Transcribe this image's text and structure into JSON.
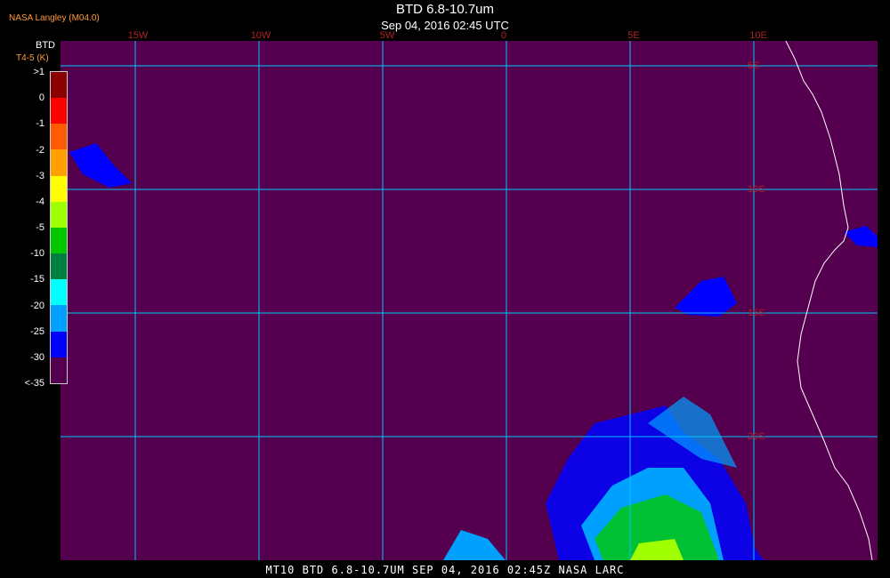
{
  "header": {
    "source": "NASA Langley (M04.0)",
    "title": "BTD 6.8-10.7um",
    "datetime": "Sep 04, 2016 02:45 UTC"
  },
  "legend": {
    "title": "BTD",
    "units": "T4-5 (K)",
    "ticks": [
      ">1",
      "0",
      "-1",
      "-2",
      "-3",
      "-4",
      "-5",
      "-10",
      "-15",
      "-20",
      "-25",
      "-30",
      "<-35"
    ],
    "colors": [
      "#8b0000",
      "#ff0000",
      "#ff5a00",
      "#ffa000",
      "#ffff00",
      "#a0ff00",
      "#00c800",
      "#008040",
      "#00ffff",
      "#00a0ff",
      "#0000ff",
      "#55004f"
    ]
  },
  "map": {
    "lon_labels": [
      "15W",
      "10W",
      "5W",
      "0",
      "5E",
      "10E"
    ],
    "lat_labels": [
      "5S",
      "10S",
      "15S",
      "20S"
    ],
    "background": "#55004f",
    "grid_color": "#00c8ff",
    "coast_color": "#ffffff"
  },
  "footer": "MT10  BTD 6.8-10.7UM   SEP 04, 2016 02:45Z   NASA LARC"
}
